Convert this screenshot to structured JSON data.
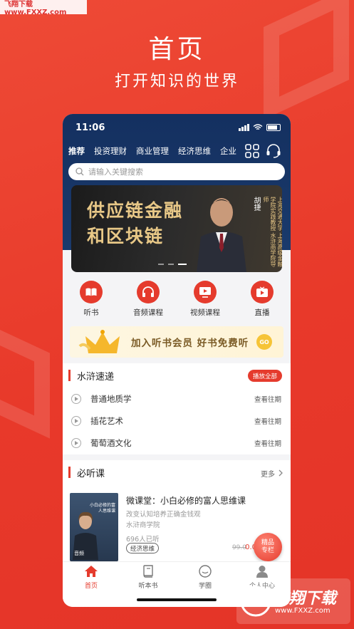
{
  "watermark_top": "飞翔下载 www.FXXZ.com",
  "promo": {
    "title": "首页",
    "subtitle": "打开知识的世界"
  },
  "status_bar": {
    "time": "11:06"
  },
  "nav": {
    "tabs": [
      "推荐",
      "投资理财",
      "商业管理",
      "经济思维",
      "企业"
    ],
    "grid_icon": "grid-icon",
    "service_icon": "headset-icon"
  },
  "search": {
    "placeholder": "请输入关键搜索"
  },
  "banner": {
    "title": "供应链金融\n和区块链",
    "name": "胡捷",
    "desc": "上海交通大学 上海高级金融学院实践教授 水浒商学院导师"
  },
  "quick_links": [
    {
      "label": "听书",
      "icon": "book-icon"
    },
    {
      "label": "音频课程",
      "icon": "headphones-icon"
    },
    {
      "label": "视频课程",
      "icon": "monitor-icon"
    },
    {
      "label": "直播",
      "icon": "play-icon"
    }
  ],
  "vip": {
    "text": "加入听书会员  好书免费听",
    "go": "GO"
  },
  "shuihu": {
    "title": "水浒速递",
    "play_all": "播放全部",
    "items": [
      {
        "title": "普通地质学",
        "past": "查看往期"
      },
      {
        "title": "插花艺术",
        "past": "查看往期"
      },
      {
        "title": "葡萄酒文化",
        "past": "查看往期"
      }
    ]
  },
  "must_listen": {
    "title": "必听课",
    "more": "更多",
    "course": {
      "cover_text": "小白必修的富人思维课",
      "cover_tag": "音频",
      "title": "微课堂：小白必修的富人思维课",
      "desc": "改变认知培养正确金钱观",
      "org": "水浒商学院",
      "count": "696人已听",
      "tag": "经济思维",
      "price_old": "99.0",
      "price_new": "0.0"
    },
    "badge": "精品专栏"
  },
  "tabbar": [
    {
      "label": "首页",
      "icon": "home-icon"
    },
    {
      "label": "听本书",
      "icon": "book-icon"
    },
    {
      "label": "学圈",
      "icon": "chat-icon"
    },
    {
      "label": "个人中心",
      "icon": "user-icon"
    }
  ],
  "watermark_bottom": {
    "main": "飞翔下载",
    "url": "www.FXXZ.com"
  },
  "colors": {
    "brand_red": "#e53b2d",
    "navy": "#143060",
    "gold": "#e8c887"
  }
}
